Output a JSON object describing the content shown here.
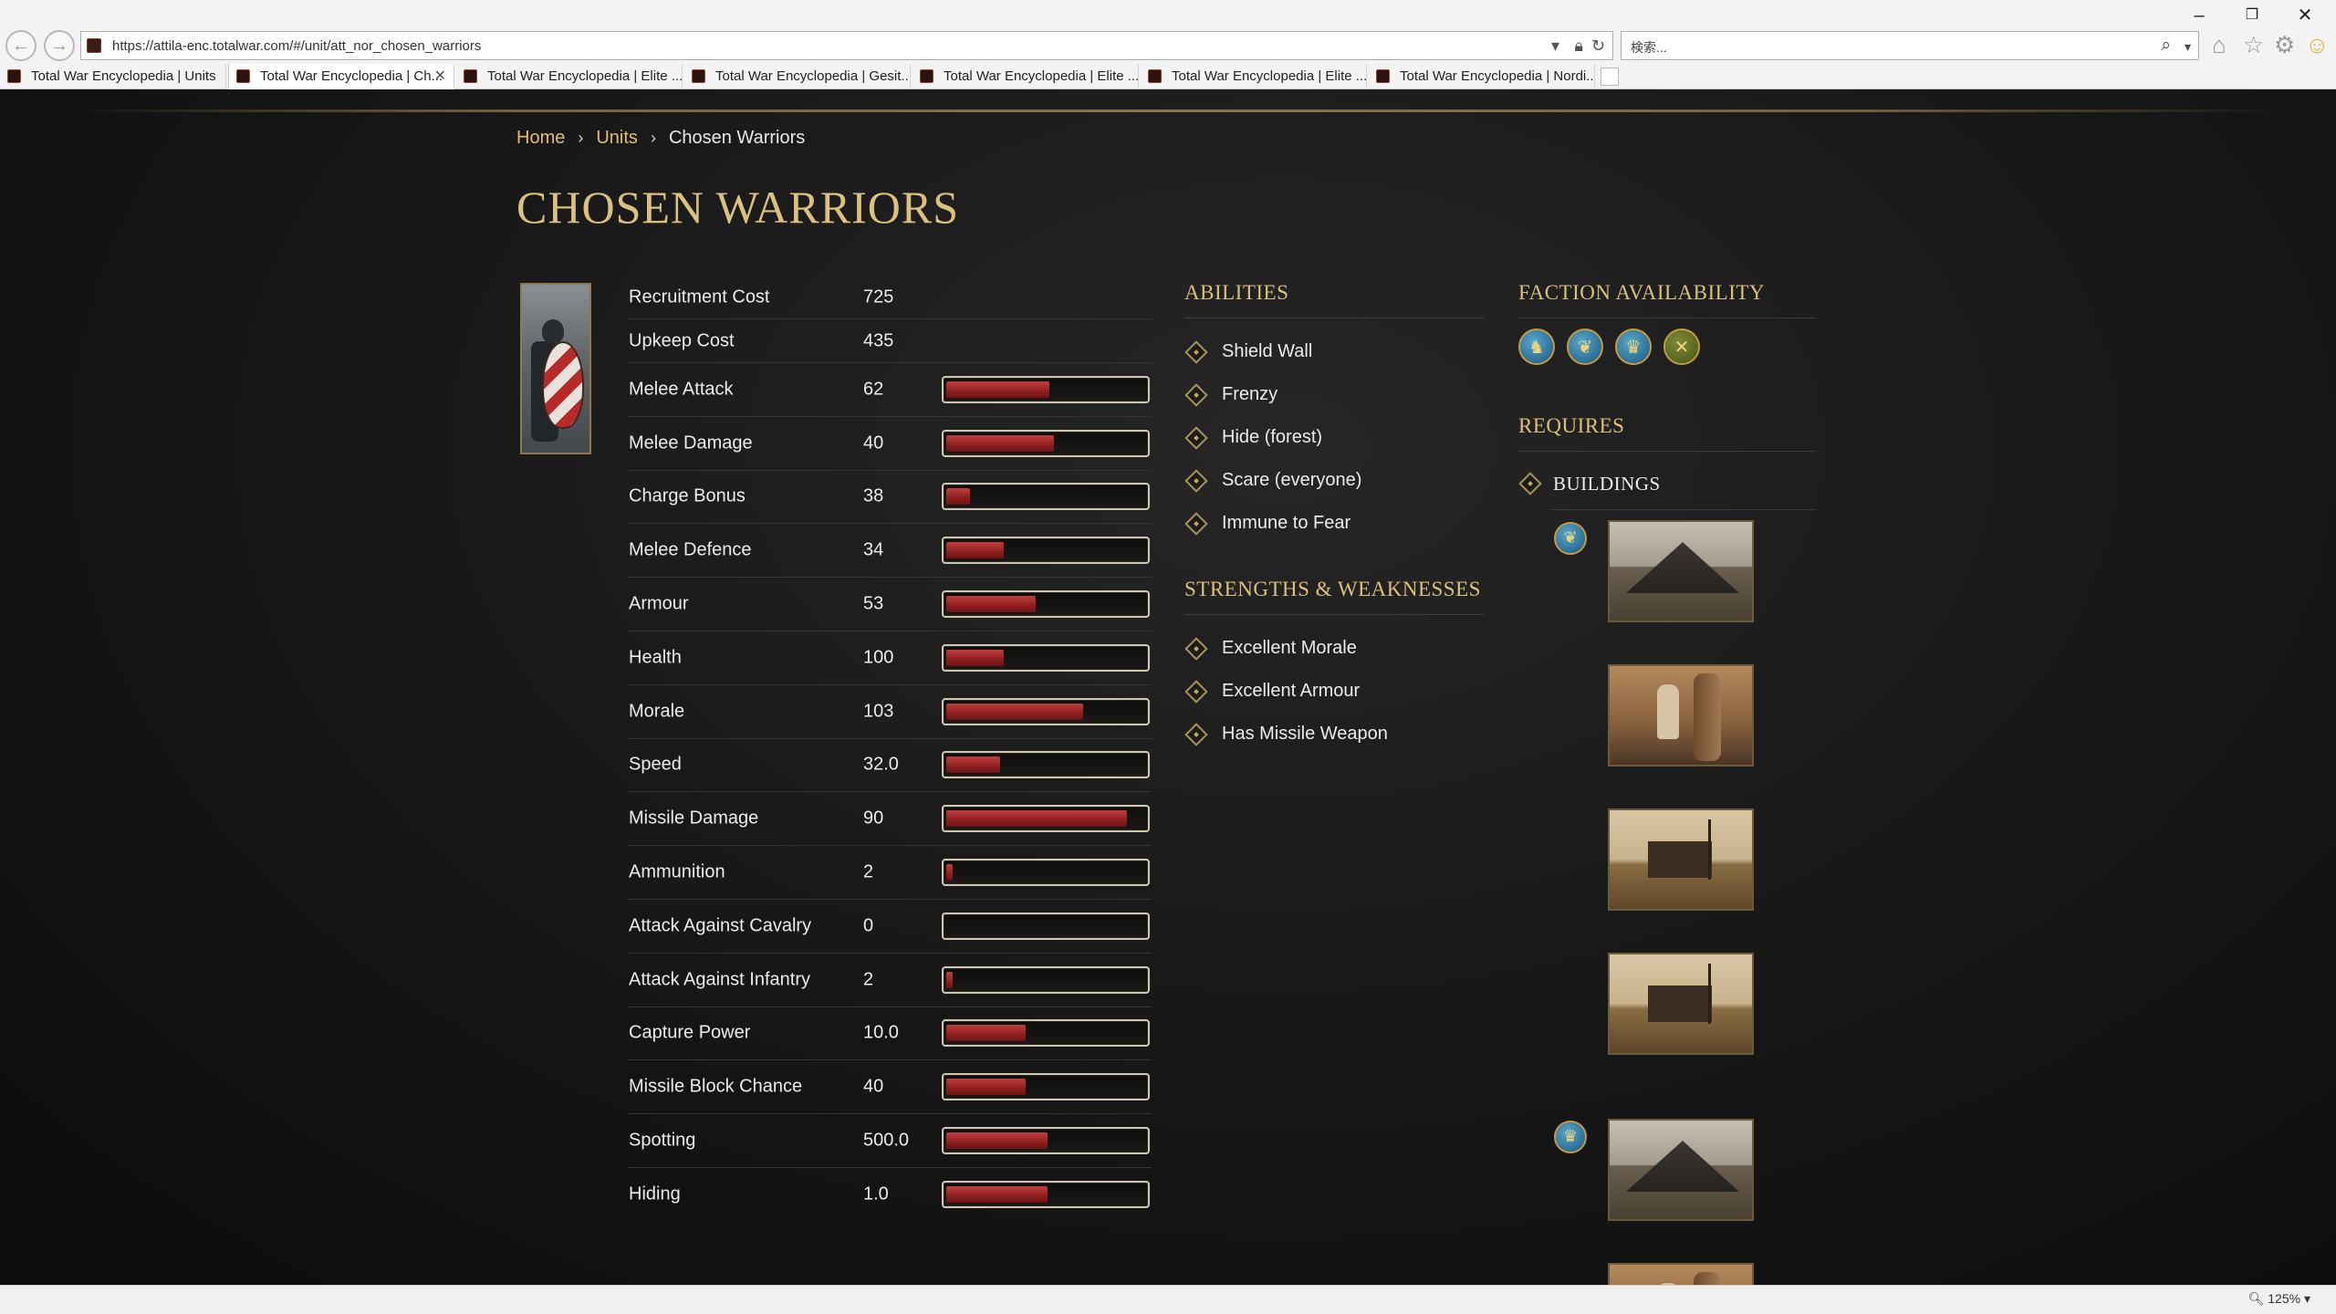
{
  "browser": {
    "url": "https://attila-enc.totalwar.com/#/unit/att_nor_chosen_warriors",
    "search_placeholder": "検索...",
    "zoom": "125%",
    "tabs": [
      {
        "title": "Total War Encyclopedia | Units"
      },
      {
        "title": "Total War Encyclopedia | Ch..."
      },
      {
        "title": "Total War Encyclopedia | Elite ..."
      },
      {
        "title": "Total War Encyclopedia | Gesit..."
      },
      {
        "title": "Total War Encyclopedia | Elite ..."
      },
      {
        "title": "Total War Encyclopedia | Elite ..."
      },
      {
        "title": "Total War Encyclopedia | Nordi..."
      }
    ]
  },
  "breadcrumb": {
    "home": "Home",
    "units": "Units",
    "current": "Chosen Warriors"
  },
  "page": {
    "title": "CHOSEN WARRIORS"
  },
  "stats": [
    {
      "label": "Recruitment Cost",
      "value": "725"
    },
    {
      "label": "Upkeep Cost",
      "value": "435"
    },
    {
      "label": "Melee Attack",
      "value": "62",
      "fill": 0.52
    },
    {
      "label": "Melee Damage",
      "value": "40",
      "fill": 0.54
    },
    {
      "label": "Charge Bonus",
      "value": "38",
      "fill": 0.12
    },
    {
      "label": "Melee Defence",
      "value": "34",
      "fill": 0.29
    },
    {
      "label": "Armour",
      "value": "53",
      "fill": 0.45
    },
    {
      "label": "Health",
      "value": "100",
      "fill": 0.29
    },
    {
      "label": "Morale",
      "value": "103",
      "fill": 0.69
    },
    {
      "label": "Speed",
      "value": "32.0",
      "fill": 0.27
    },
    {
      "label": "Missile Damage",
      "value": "90",
      "fill": 0.91
    },
    {
      "label": "Ammunition",
      "value": "2",
      "fill": 0.03
    },
    {
      "label": "Attack Against Cavalry",
      "value": "0",
      "fill": 0.0
    },
    {
      "label": "Attack Against Infantry",
      "value": "2",
      "fill": 0.03
    },
    {
      "label": "Capture Power",
      "value": "10.0",
      "fill": 0.4
    },
    {
      "label": "Missile Block Chance",
      "value": "40",
      "fill": 0.4
    },
    {
      "label": "Spotting",
      "value": "500.0",
      "fill": 0.51
    },
    {
      "label": "Hiding",
      "value": "1.0",
      "fill": 0.51
    }
  ],
  "abilities": {
    "heading": "ABILITIES",
    "items": [
      "Shield Wall",
      "Frenzy",
      "Hide (forest)",
      "Scare (everyone)",
      "Immune to Fear"
    ]
  },
  "strengths": {
    "heading": "STRENGTHS & WEAKNESSES",
    "items": [
      "Excellent Morale",
      "Excellent Armour",
      "Has Missile Weapon"
    ]
  },
  "factions": {
    "heading": "FACTION AVAILABILITY",
    "icons": [
      "seahorse-emblem-icon",
      "dragon-emblem-icon",
      "crown-emblem-icon",
      "crossed-axes-emblem-icon"
    ]
  },
  "requires": {
    "heading": "REQUIRES",
    "buildings_label": "BUILDINGS"
  },
  "colors": {
    "accent_gold": "#dcc17a",
    "bar_fill": "#a52a2a",
    "page_bg": "#161616"
  }
}
